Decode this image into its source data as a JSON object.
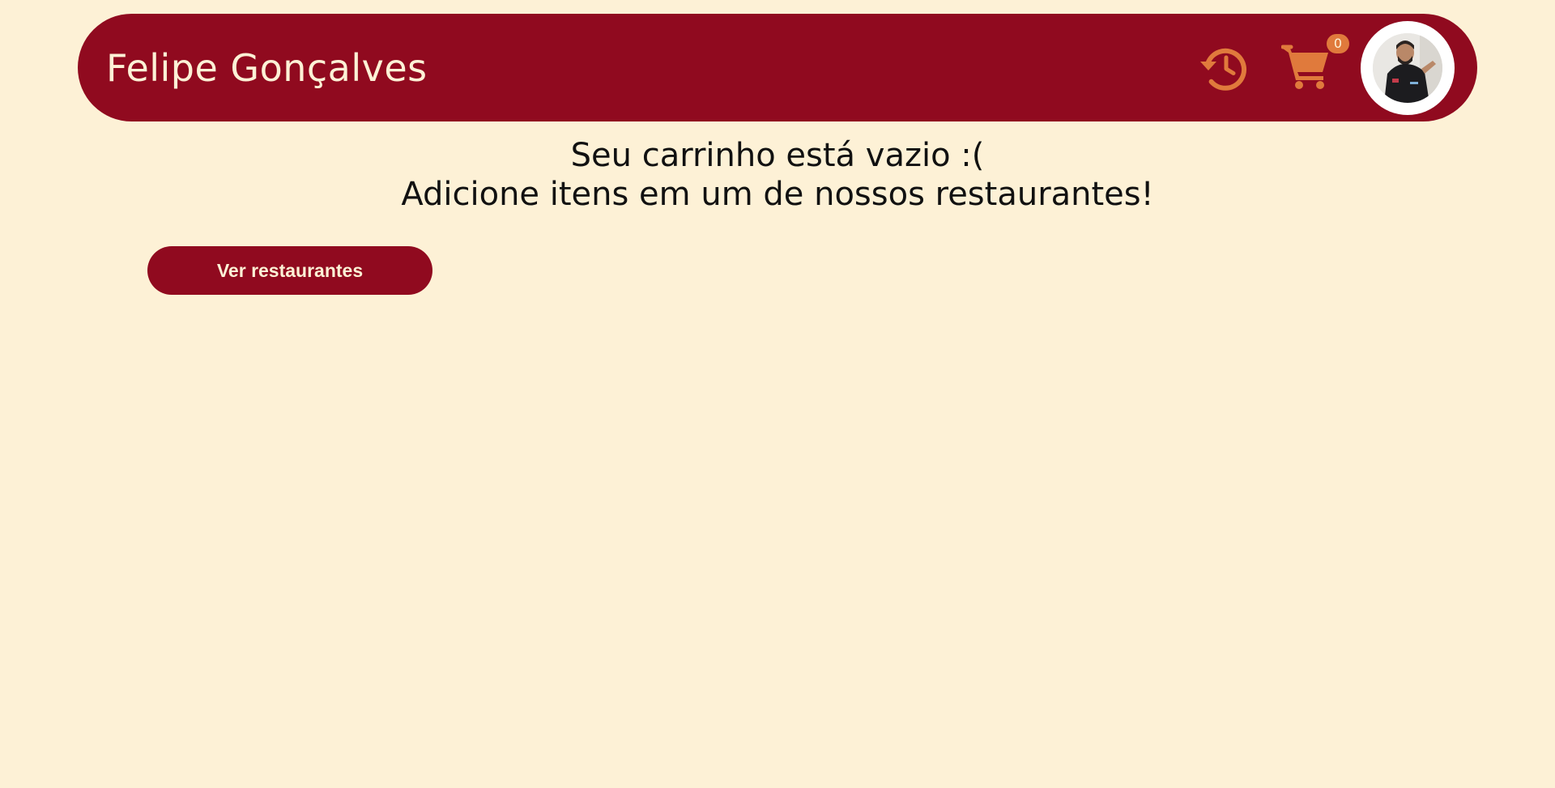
{
  "header": {
    "user_name": "Felipe Gonçalves",
    "history_icon": "history-clock-icon",
    "cart_icon": "shopping-cart-icon",
    "cart_count": "0",
    "avatar_label": "user-avatar"
  },
  "empty_cart": {
    "line1": "Seu carrinho está vazio :(",
    "line2": "Adicione itens em um de nossos restaurantes!"
  },
  "actions": {
    "see_restaurants_label": "Ver restaurantes"
  },
  "colors": {
    "background": "#fdf1d6",
    "primary": "#900a1f",
    "accent": "#e07a3c"
  }
}
